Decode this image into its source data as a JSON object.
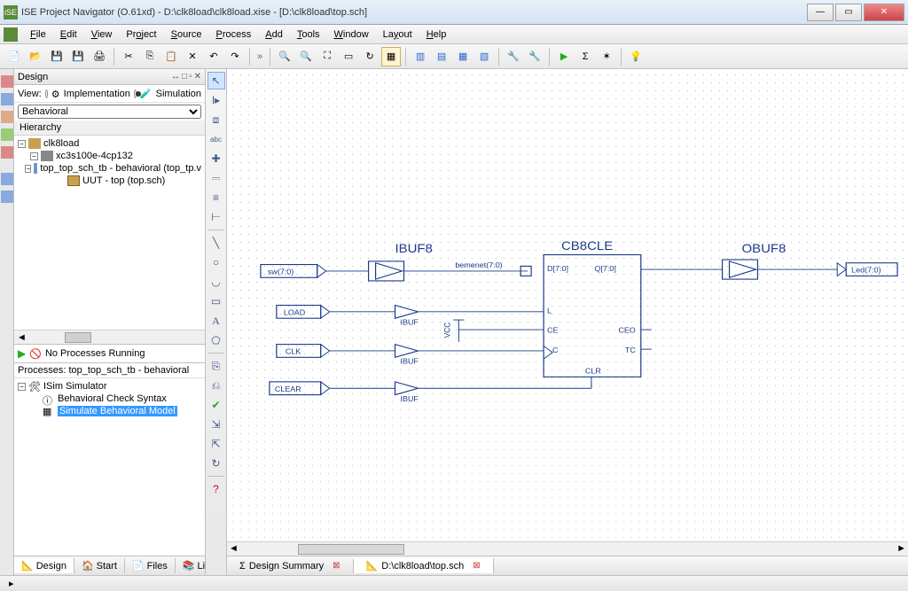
{
  "titlebar": {
    "text": "ISE Project Navigator (O.61xd) - D:\\clk8load\\clk8load.xise - [D:\\clk8load\\top.sch]"
  },
  "menu": {
    "file": "File",
    "edit": "Edit",
    "view": "View",
    "project": "Project",
    "source": "Source",
    "process": "Process",
    "add": "Add",
    "tools": "Tools",
    "window": "Window",
    "layout": "Layout",
    "help": "Help"
  },
  "design_panel": {
    "title": "Design",
    "view_label": "View:",
    "implementation": "Implementation",
    "simulation": "Simulation",
    "behavioral_option": "Behavioral",
    "hierarchy_label": "Hierarchy",
    "tree": {
      "root": "clk8load",
      "device": "xc3s100e-4cp132",
      "tb": "top_top_sch_tb - behavioral (top_tp.v",
      "uut": "UUT - top (top.sch)"
    }
  },
  "processes": {
    "status": "No Processes Running",
    "header": "Processes: top_top_sch_tb - behavioral",
    "sim_group": "ISim Simulator",
    "check_syntax": "Behavioral Check Syntax",
    "simulate": "Simulate Behavioral Model"
  },
  "bottom_tabs": {
    "design": "Design",
    "start": "Start",
    "files": "Files",
    "libraries": "Librari"
  },
  "vtools": {
    "pointer": "pointer",
    "rename": "rename",
    "add-symbol": "add-symbol",
    "abc": "abc",
    "plus": "plus",
    "net": "net",
    "bus": "bus",
    "bustap": "bustap",
    "line": "line",
    "circle": "circle",
    "arc": "arc",
    "rect": "rect",
    "text": "text",
    "poly": "poly"
  },
  "schematic": {
    "ibuf8": "IBUF8",
    "obuf8": "OBUF8",
    "cb8cle": "CB8CLE",
    "ibuf": "IBUF",
    "vcc": "VCC",
    "bemenet": "bemenet(7:0)",
    "d": "D[7:0]",
    "q": "Q[7:0]",
    "l": "L",
    "ce": "CE",
    "c": "C",
    "clr": "CLR",
    "ceo": "CEO",
    "tc": "TC",
    "sw": "sw(7:0)",
    "led": "Led(7:0)",
    "load": "LOAD",
    "clk": "CLK",
    "clear": "CLEAR"
  },
  "doc_tabs": {
    "summary": "Design Summary",
    "schematic_path": "D:\\clk8load\\top.sch"
  },
  "statusbar": {}
}
